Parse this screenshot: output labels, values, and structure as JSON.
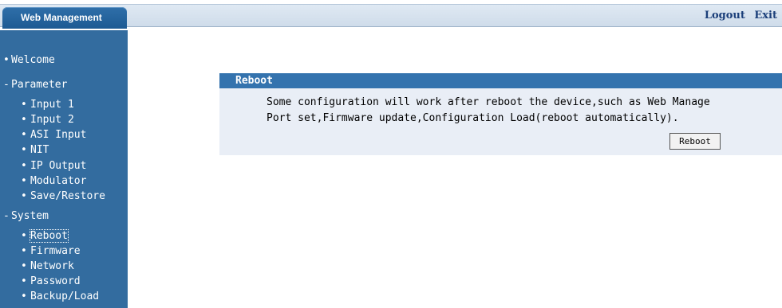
{
  "header": {
    "title": "Web Management",
    "links": {
      "logout": "Logout",
      "exit": "Exit"
    }
  },
  "sidebar": {
    "welcome": "Welcome",
    "parameter": {
      "label": "Parameter",
      "items": [
        "Input 1",
        "Input 2",
        "ASI Input",
        "NIT",
        "IP Output",
        "Modulator",
        "Save/Restore"
      ]
    },
    "system": {
      "label": "System",
      "items": [
        "Reboot",
        "Firmware",
        "Network",
        "Password",
        "Backup/Load"
      ]
    },
    "active_item": "Reboot"
  },
  "panel": {
    "title": "Reboot",
    "line1": "Some configuration will work after reboot the device,such as Web Manage",
    "line2": "Port set,Firmware update,Configuration Load(reboot automatically).",
    "button_label": "Reboot"
  },
  "colors": {
    "sidebar_bg": "#336c9f",
    "panel_header": "#3473ae",
    "panel_bg": "#e9eef6",
    "link": "#1b3f7a"
  }
}
